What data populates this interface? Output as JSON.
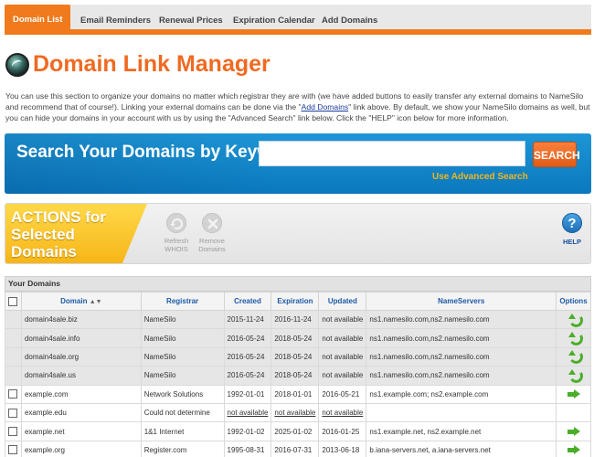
{
  "tabs": [
    {
      "label": "Domain List",
      "active": true
    },
    {
      "label": "Email Reminders",
      "active": false
    },
    {
      "label": "Renewal Prices",
      "active": false
    },
    {
      "label": "Expiration Calendar",
      "active": false
    },
    {
      "label": "Add Domains",
      "active": false
    }
  ],
  "page": {
    "title": "Domain Link Manager",
    "intro_before_link": "You can use this section to organize your domains no matter which registrar they are with (we have added buttons to easily transfer any external domains to NameSilo and recommend that of course!). Linking your external domains can be done via the \"",
    "intro_link": "Add Domains",
    "intro_after_link": "\" link above. By default, we show your NameSilo domains as well, but you can hide your domains in your account with us by using the \"Advanced Search\" link below. Click the \"HELP\" icon below for more information."
  },
  "search": {
    "label": "Search Your Domains by Keyword",
    "value": "",
    "button": "SEARCH",
    "advanced_link": "Use Advanced Search"
  },
  "actions": {
    "heading_line1": "ACTIONS for",
    "heading_line2": "Selected",
    "heading_line3": "Domains",
    "refresh_line1": "Refresh",
    "refresh_line2": "WHOIS",
    "remove_line1": "Remove",
    "remove_line2": "Domains",
    "help": "HELP"
  },
  "table": {
    "section_title": "Your Domains",
    "columns": {
      "domain": "Domain",
      "registrar": "Registrar",
      "created": "Created",
      "expiration": "Expiration",
      "updated": "Updated",
      "nameservers": "NameServers",
      "options": "Options"
    },
    "rows": [
      {
        "domain": "domain4sale.biz",
        "registrar": "NameSilo",
        "created": "2015-11-24",
        "expiration": "2016-11-24",
        "updated": "not available",
        "nameservers": "ns1.namesilo.com,ns2.namesilo.com",
        "namesilo": true,
        "option": "manage"
      },
      {
        "domain": "domain4sale.info",
        "registrar": "NameSilo",
        "created": "2016-05-24",
        "expiration": "2018-05-24",
        "updated": "not available",
        "nameservers": "ns1.namesilo.com,ns2.namesilo.com",
        "namesilo": true,
        "option": "manage"
      },
      {
        "domain": "domain4sale.org",
        "registrar": "NameSilo",
        "created": "2016-05-24",
        "expiration": "2018-05-24",
        "updated": "not available",
        "nameservers": "ns1.namesilo.com,ns2.namesilo.com",
        "namesilo": true,
        "option": "manage"
      },
      {
        "domain": "domain4sale.us",
        "registrar": "NameSilo",
        "created": "2016-05-24",
        "expiration": "2018-05-24",
        "updated": "not available",
        "nameservers": "ns1.namesilo.com,ns2.namesilo.com",
        "namesilo": true,
        "option": "manage"
      },
      {
        "domain": "example.com",
        "registrar": "Network Solutions",
        "created": "1992-01-01",
        "expiration": "2018-01-01",
        "updated": "2016-05-21",
        "nameservers": "ns1.example.com; ns2.example.com",
        "namesilo": false,
        "option": "transfer"
      },
      {
        "domain": "example.edu",
        "registrar": "Could not determine",
        "created": "not available",
        "expiration": "not available",
        "updated": "not available",
        "nameservers": "",
        "namesilo": false,
        "option": "none"
      },
      {
        "domain": "example.net",
        "registrar": "1&1 Internet",
        "created": "1992-01-02",
        "expiration": "2025-01-02",
        "updated": "2016-01-25",
        "nameservers": "ns1.example.net, ns2.example.net",
        "namesilo": false,
        "option": "transfer"
      },
      {
        "domain": "example.org",
        "registrar": "Register.com",
        "created": "1995-08-31",
        "expiration": "2016-07-31",
        "updated": "2013-06-18",
        "nameservers": "b.iana-servers.net, a.iana-servers.net",
        "namesilo": false,
        "option": "transfer"
      }
    ]
  },
  "colors": {
    "accent_orange": "#f07a1c",
    "title_orange": "#ef6a22",
    "search_blue": "#0a78bd",
    "actions_yellow": "#f7b416",
    "link_blue": "#1d5aa6",
    "arrow_green": "#4bae2a"
  },
  "icons": {
    "logo": "namesilo-globe-logo",
    "refresh": "refresh-icon",
    "remove": "close-icon",
    "help": "question-icon",
    "manage": "curved-arrow-icon",
    "transfer": "right-arrow-icon"
  }
}
